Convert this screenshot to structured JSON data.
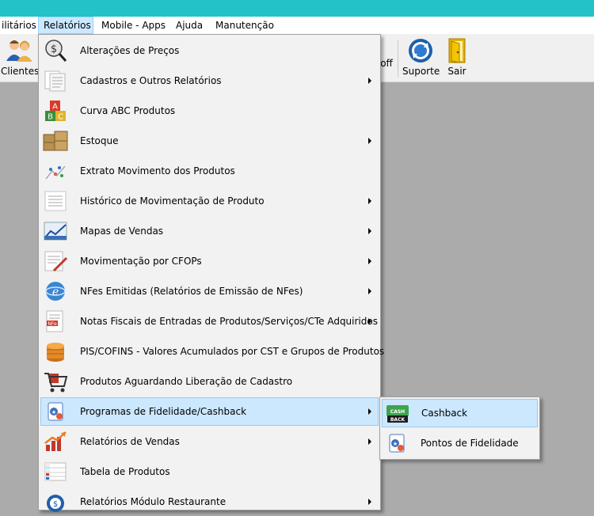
{
  "menubar": {
    "items": [
      "ilitários",
      "Relatórios",
      "Mobile - Apps",
      "Ajuda",
      "Manutenção"
    ]
  },
  "toolbar": {
    "clientes": "Clientes",
    "off": "off",
    "suporte": "Suporte",
    "sair": "Sair"
  },
  "dropdown": {
    "items": [
      {
        "label": "Alterações de Preços",
        "icon": "price-change-icon",
        "submenu": false
      },
      {
        "label": "Cadastros e Outros Relatórios",
        "icon": "documents-icon",
        "submenu": true
      },
      {
        "label": "Curva ABC Produtos",
        "icon": "abc-blocks-icon",
        "submenu": false
      },
      {
        "label": "Estoque",
        "icon": "boxes-icon",
        "submenu": true
      },
      {
        "label": "Extrato Movimento dos Produtos",
        "icon": "scatter-chart-icon",
        "submenu": false
      },
      {
        "label": "Histórico de Movimentação de Produto",
        "icon": "list-document-icon",
        "submenu": true
      },
      {
        "label": "Mapas de Vendas",
        "icon": "sales-map-icon",
        "submenu": true
      },
      {
        "label": "Movimentação por CFOPs",
        "icon": "report-pen-icon",
        "submenu": true
      },
      {
        "label": "NFes Emitidas (Relatórios de Emissão de NFes)",
        "icon": "nfe-globe-icon",
        "submenu": true
      },
      {
        "label": "Notas Fiscais de Entradas de Produtos/Serviços/CTe Adquiridos",
        "icon": "invoice-icon",
        "submenu": true
      },
      {
        "label": "PIS/COFINS - Valores Acumulados por CST e Grupos de Produtos",
        "icon": "coins-stack-icon",
        "submenu": false
      },
      {
        "label": "Produtos Aguardando Liberação de Cadastro",
        "icon": "shopping-cart-icon",
        "submenu": false
      },
      {
        "label": "Programas de Fidelidade/Cashback",
        "icon": "loyalty-card-icon",
        "submenu": true
      },
      {
        "label": "Relatórios de Vendas",
        "icon": "bar-chart-up-icon",
        "submenu": true
      },
      {
        "label": "Tabela de Produtos",
        "icon": "table-icon",
        "submenu": false
      },
      {
        "label": "Relatórios Módulo Restaurante",
        "icon": "restaurant-icon",
        "submenu": true
      }
    ]
  },
  "submenu": {
    "items": [
      {
        "label": "Cashback",
        "icon": "cashback-icon"
      },
      {
        "label": "Pontos de Fidelidade",
        "icon": "loyalty-card-icon"
      }
    ]
  },
  "colors": {
    "titlebar": "#22c2c8",
    "highlight": "#cce8ff",
    "highlight_border": "#99c9ef",
    "workspace": "#ababab"
  }
}
